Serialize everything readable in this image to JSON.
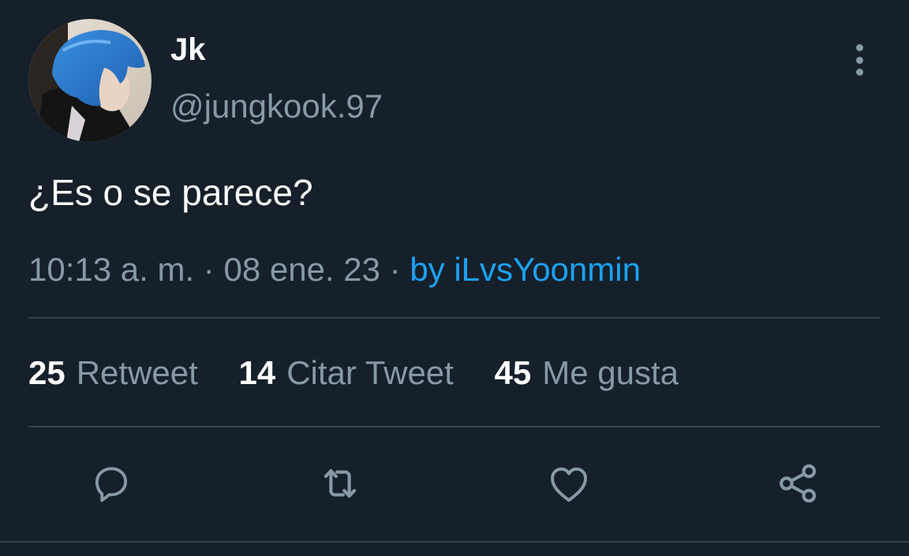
{
  "user": {
    "display_name": "Jk",
    "handle": "@jungkook.97"
  },
  "tweet": {
    "text": "¿Es o se parece?",
    "time": "10:13 a. m.",
    "separator": "·",
    "date": "08 ene. 23",
    "source": "by iLvsYoonmin"
  },
  "stats": [
    {
      "count": "25",
      "label": "Retweet"
    },
    {
      "count": "14",
      "label": "Citar Tweet"
    },
    {
      "count": "45",
      "label": "Me gusta"
    }
  ],
  "actions": [
    "reply-icon",
    "retweet-icon",
    "like-icon",
    "share-icon"
  ],
  "colors": {
    "background": "#15202b",
    "text": "#ffffff",
    "muted": "#8899a6",
    "link": "#1da1f2",
    "divider": "#38444d"
  }
}
